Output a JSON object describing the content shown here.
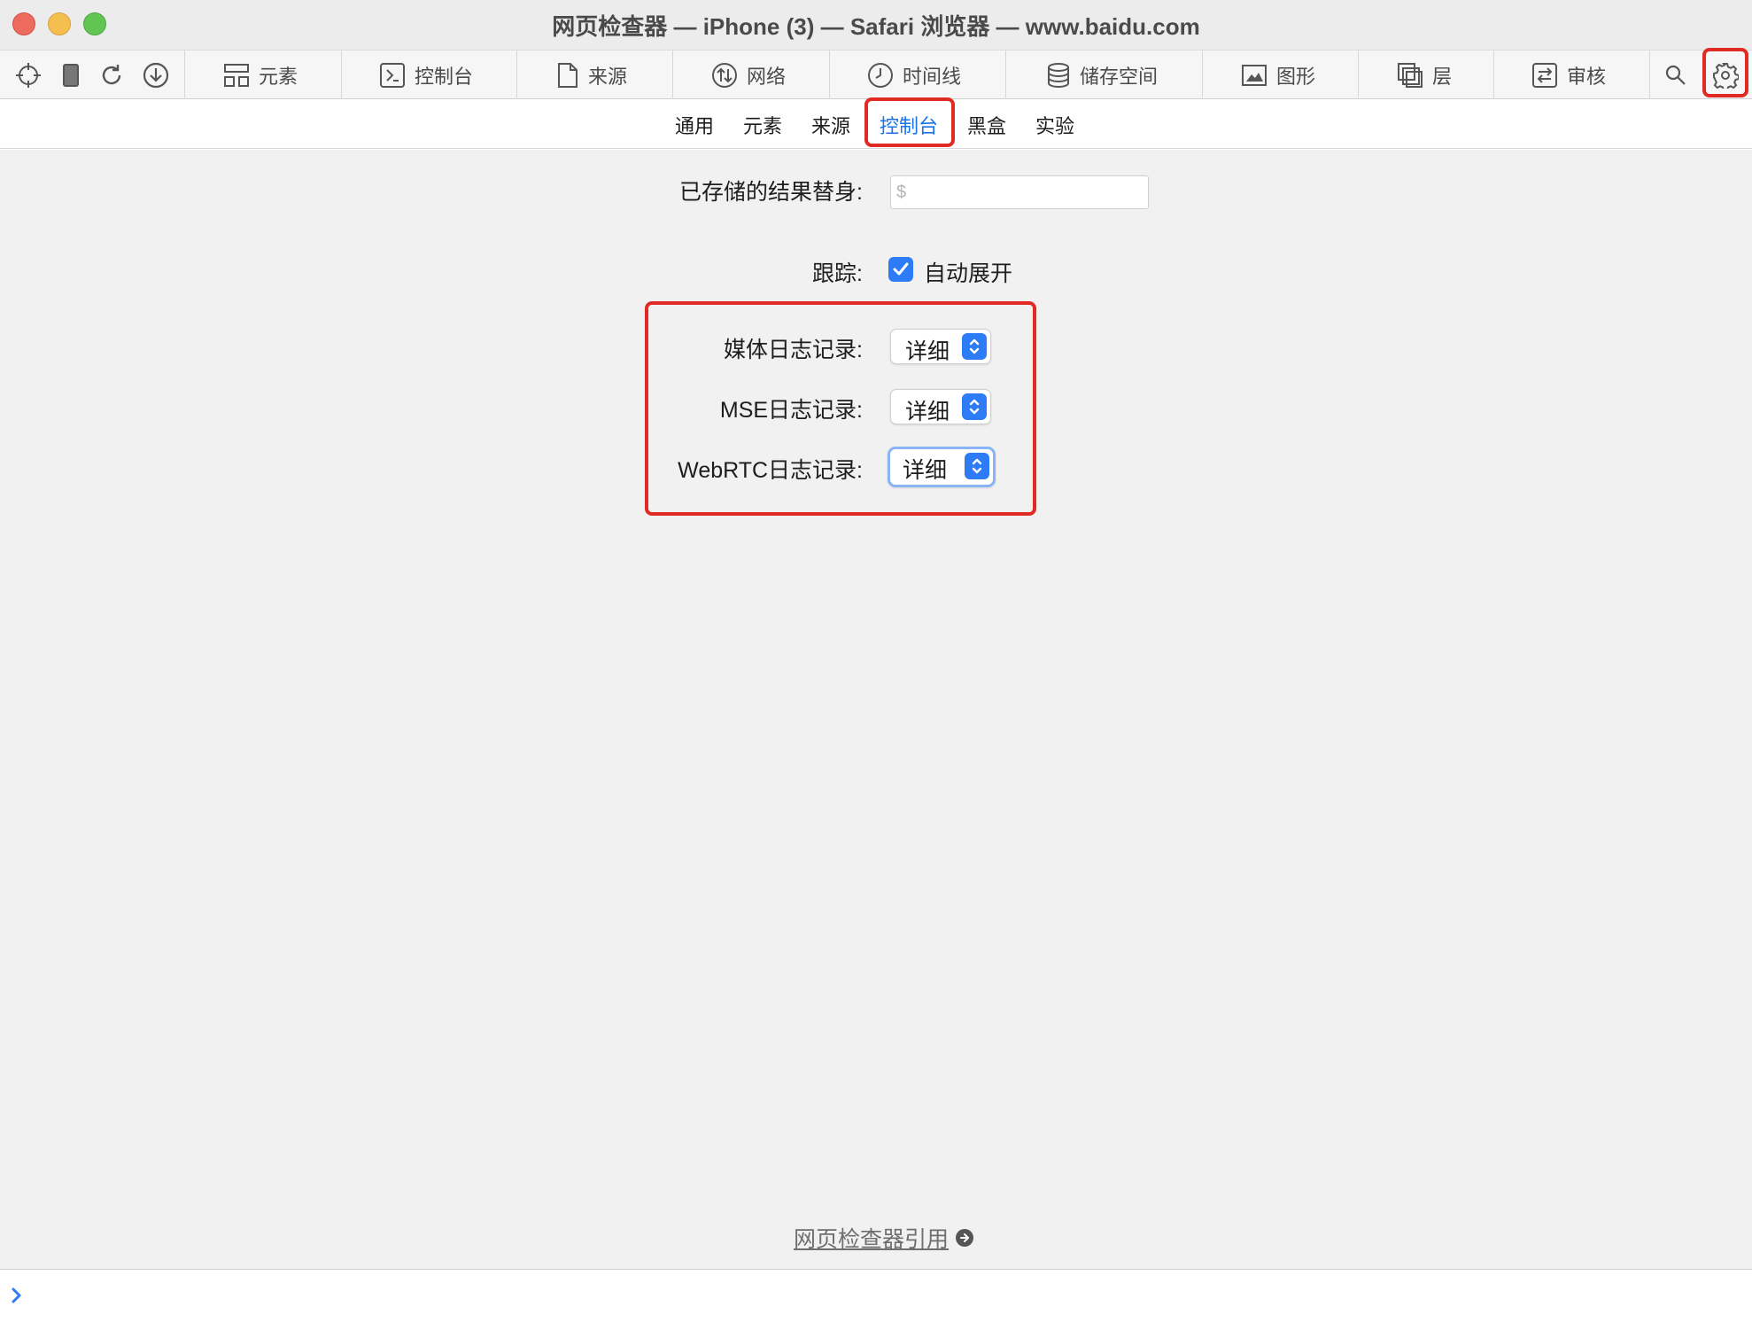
{
  "window": {
    "title": "网页检查器 — iPhone (3) — Safari 浏览器 — www.baidu.com"
  },
  "toolbar": {
    "left_icons": [
      "crosshair-icon",
      "device-icon",
      "reload-icon",
      "download-icon"
    ],
    "tabs": [
      {
        "label": "元素",
        "icon": "elements-icon"
      },
      {
        "label": "控制台",
        "icon": "console-icon"
      },
      {
        "label": "来源",
        "icon": "sources-icon"
      },
      {
        "label": "网络",
        "icon": "network-icon"
      },
      {
        "label": "时间线",
        "icon": "timeline-icon"
      },
      {
        "label": "储存空间",
        "icon": "storage-icon"
      },
      {
        "label": "图形",
        "icon": "graphics-icon"
      },
      {
        "label": "层",
        "icon": "layers-icon"
      },
      {
        "label": "审核",
        "icon": "audit-icon"
      }
    ],
    "right_icons": [
      "search-icon",
      "gear-icon"
    ]
  },
  "subtabs": {
    "items": [
      "通用",
      "元素",
      "来源",
      "控制台",
      "黑盒",
      "实验"
    ],
    "active": "控制台"
  },
  "settings": {
    "alias": {
      "label": "已存储的结果替身:",
      "placeholder": "$"
    },
    "trace": {
      "label": "跟踪:",
      "checkbox_label": "自动展开",
      "checked": true
    },
    "media_logging": {
      "label": "媒体日志记录:",
      "value": "详细"
    },
    "mse_logging": {
      "label": "MSE日志记录:",
      "value": "详细"
    },
    "webrtc_logging": {
      "label": "WebRTC日志记录:",
      "value": "详细"
    }
  },
  "footer": {
    "reference_link": "网页检查器引用"
  },
  "colors": {
    "accent": "#2d7cf6",
    "active_tab_text": "#1a73e8",
    "annotation": "#e02a23",
    "content_bg": "#f1f1f1"
  }
}
